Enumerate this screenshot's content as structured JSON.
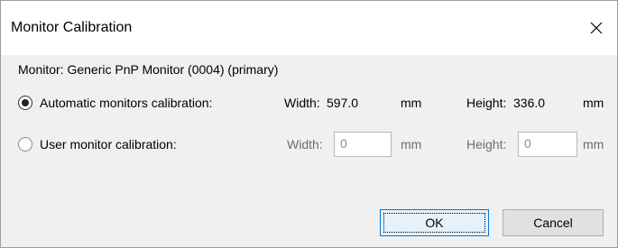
{
  "window": {
    "title": "Monitor Calibration"
  },
  "monitor": {
    "label": "Monitor: Generic PnP Monitor (0004) (primary)"
  },
  "automatic": {
    "label": "Automatic monitors calibration:",
    "selected": true,
    "width_label": "Width:",
    "width_value": "597.0",
    "width_unit": "mm",
    "height_label": "Height:",
    "height_value": "336.0",
    "height_unit": "mm"
  },
  "user": {
    "label": "User monitor calibration:",
    "selected": false,
    "width_label": "Width:",
    "width_value": "0",
    "width_unit": "mm",
    "height_label": "Height:",
    "height_value": "0",
    "height_unit": "mm"
  },
  "buttons": {
    "ok": "OK",
    "cancel": "Cancel"
  }
}
